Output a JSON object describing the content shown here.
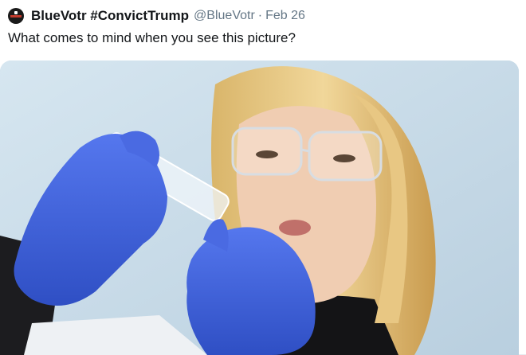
{
  "tweet": {
    "author_name": "BlueVotr #ConvictTrump",
    "handle": "@BlueVotr",
    "separator": "·",
    "date": "Feb 26",
    "text": "What comes to mind when you see this picture?"
  },
  "colors": {
    "text_primary": "#14171a",
    "text_secondary": "#657786",
    "glove_blue": "#3d5fd6",
    "background_blue": "#c5d9e6"
  },
  "icons": {
    "avatar": "avatar-icon"
  }
}
